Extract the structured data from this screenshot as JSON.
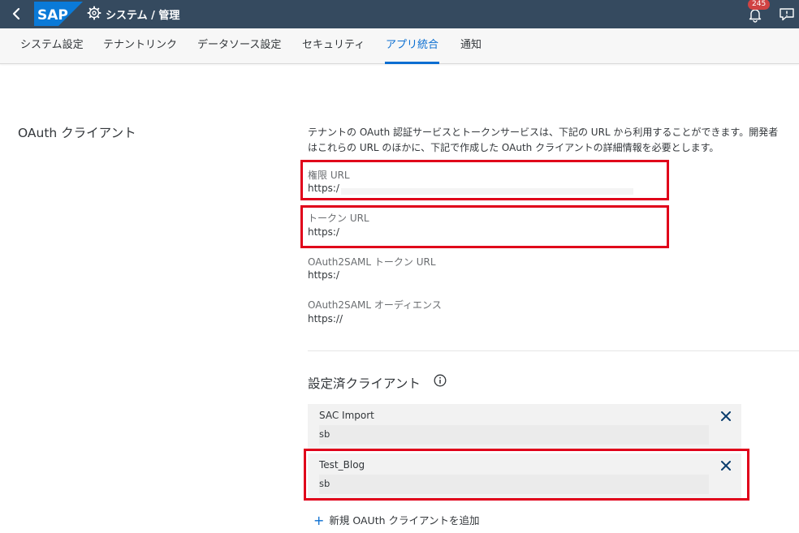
{
  "shell": {
    "title": "システム / 管理",
    "notification_count": "245",
    "brand": "SAP"
  },
  "tabs": [
    {
      "label": "システム設定"
    },
    {
      "label": "テナントリンク"
    },
    {
      "label": "データソース設定"
    },
    {
      "label": "セキュリティ"
    },
    {
      "label": "アプリ統合",
      "active": true
    },
    {
      "label": "通知"
    }
  ],
  "oauth": {
    "section_title": "OAuth クライアント",
    "description": "テナントの OAuth 認証サービスとトークンサービスは、下記の URL から利用することができます。開発者はこれらの URL のほかに、下記で作成した OAuth クライアントの詳細情報を必要とします。",
    "fields": [
      {
        "label": "権限 URL",
        "value": "https:/"
      },
      {
        "label": "トークン URL",
        "value": "https:/"
      },
      {
        "label": "OAuth2SAML トークン URL",
        "value": "https:/"
      },
      {
        "label": "OAuth2SAML オーディエンス",
        "value": "https://"
      }
    ]
  },
  "clients": {
    "title": "設定済クライアント",
    "items": [
      {
        "name": "SAC Import",
        "value": "sb"
      },
      {
        "name": "Test_Blog",
        "value": "sb"
      }
    ],
    "add_label": "新規 OAUth クライアントを追加"
  },
  "colors": {
    "shell_bg": "#354a5f",
    "accent": "#0a6ed1",
    "highlight": "#e0001a",
    "badge": "#d04343"
  }
}
